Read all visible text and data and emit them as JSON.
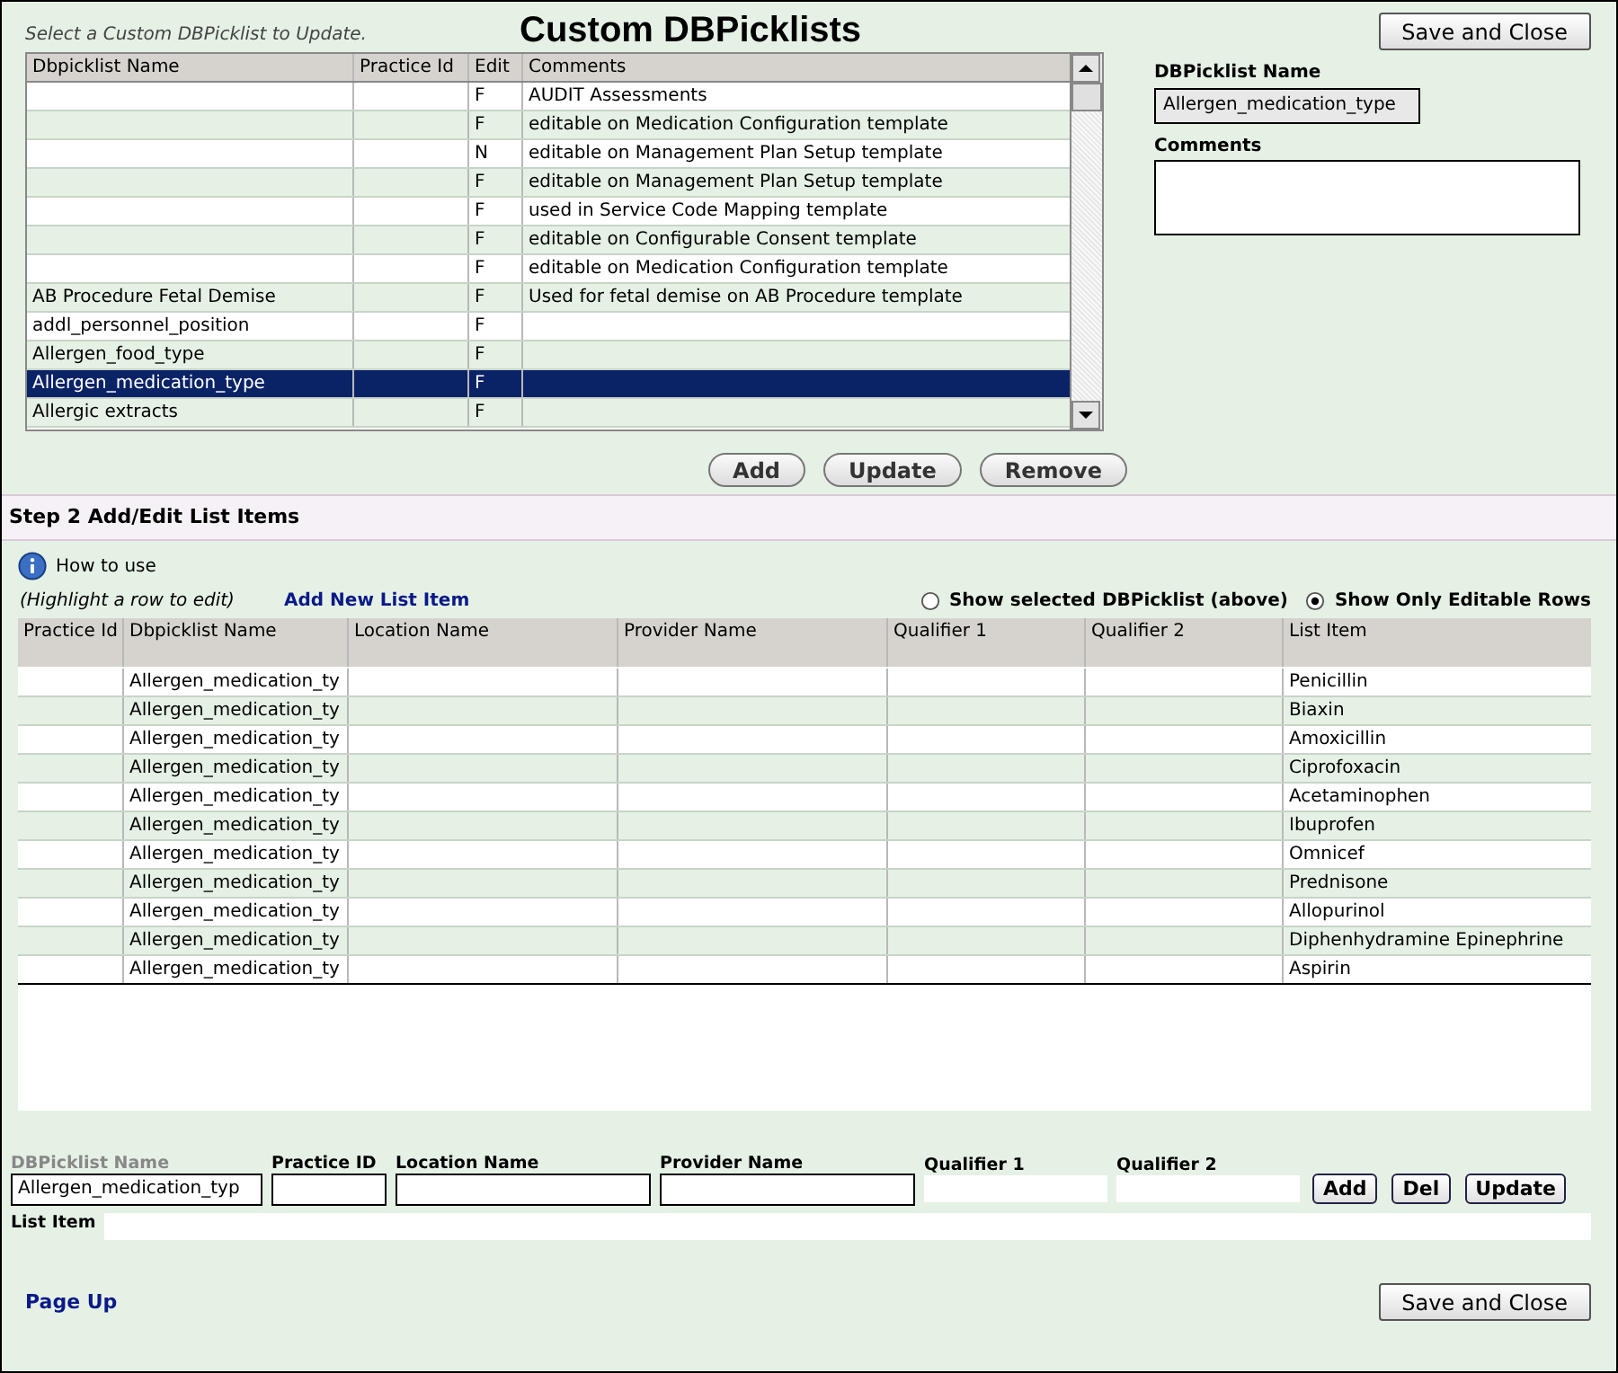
{
  "step1": {
    "instruction": "Select a Custom DBPicklist to Update.",
    "title": "Custom DBPicklists",
    "save_button": "Save and Close",
    "table": {
      "columns": [
        "Dbpicklist Name",
        "Practice Id",
        "Edit",
        "Comments"
      ],
      "rows": [
        {
          "cells": [
            "",
            "",
            "F",
            "AUDIT Assessments"
          ],
          "selected": false
        },
        {
          "cells": [
            "",
            "",
            "F",
            "editable on Medication Configuration template"
          ],
          "selected": false
        },
        {
          "cells": [
            "",
            "",
            "N",
            "editable on  Management Plan Setup template"
          ],
          "selected": false
        },
        {
          "cells": [
            "",
            "",
            "F",
            "editable on Management Plan Setup template"
          ],
          "selected": false
        },
        {
          "cells": [
            "",
            "",
            "F",
            "used in Service Code Mapping template"
          ],
          "selected": false
        },
        {
          "cells": [
            "",
            "",
            "F",
            "editable on Configurable Consent template"
          ],
          "selected": false
        },
        {
          "cells": [
            "",
            "",
            "F",
            "editable on Medication Configuration template"
          ],
          "selected": false
        },
        {
          "cells": [
            "AB Procedure Fetal Demise",
            "",
            "F",
            "Used for fetal demise on AB Procedure template"
          ],
          "selected": false
        },
        {
          "cells": [
            "addl_personnel_position",
            "",
            "F",
            ""
          ],
          "selected": false
        },
        {
          "cells": [
            "Allergen_food_type",
            "",
            "F",
            ""
          ],
          "selected": false
        },
        {
          "cells": [
            "Allergen_medication_type",
            "",
            "F",
            ""
          ],
          "selected": true
        },
        {
          "cells": [
            "Allergic extracts",
            "",
            "F",
            ""
          ],
          "selected": false
        }
      ]
    },
    "buttons": [
      "Add",
      "Update",
      "Remove"
    ],
    "name_label": "DBPicklist Name",
    "name_value": "Allergen_medication_type",
    "comments_label": "Comments"
  },
  "step2": {
    "title": "Step 2 Add/Edit List Items",
    "how_to_use": "How to use",
    "hint": "(Highlight a row to edit)",
    "add_link": "Add New List Item",
    "radios": [
      {
        "label": "Show selected DBPicklist (above)",
        "selected": false
      },
      {
        "label": "Show Only Editable Rows",
        "selected": true
      }
    ],
    "table": {
      "columns": [
        "Practice Id",
        "Dbpicklist Name",
        "Location Name",
        "Provider Name",
        "Qualifier 1",
        "Qualifier 2",
        "List Item"
      ],
      "rows": [
        [
          "",
          "Allergen_medication_ty",
          "",
          "",
          "",
          "",
          "Penicillin"
        ],
        [
          "",
          "Allergen_medication_ty",
          "",
          "",
          "",
          "",
          "Biaxin"
        ],
        [
          "",
          "Allergen_medication_ty",
          "",
          "",
          "",
          "",
          "Amoxicillin"
        ],
        [
          "",
          "Allergen_medication_ty",
          "",
          "",
          "",
          "",
          "Ciprofoxacin"
        ],
        [
          "",
          "Allergen_medication_ty",
          "",
          "",
          "",
          "",
          "Acetaminophen"
        ],
        [
          "",
          "Allergen_medication_ty",
          "",
          "",
          "",
          "",
          "Ibuprofen"
        ],
        [
          "",
          "Allergen_medication_ty",
          "",
          "",
          "",
          "",
          "Omnicef"
        ],
        [
          "",
          "Allergen_medication_ty",
          "",
          "",
          "",
          "",
          "Prednisone"
        ],
        [
          "",
          "Allergen_medication_ty",
          "",
          "",
          "",
          "",
          "Allopurinol"
        ],
        [
          "",
          "Allergen_medication_ty",
          "",
          "",
          "",
          "",
          "Diphenhydramine Epinephrine"
        ],
        [
          "",
          "Allergen_medication_ty",
          "",
          "",
          "",
          "",
          "Aspirin"
        ]
      ]
    },
    "form": [
      {
        "label": "DBPicklist Name",
        "value": "Allergen_medication_typ",
        "disabled": true,
        "kind": "boxed"
      },
      {
        "label": "Practice ID",
        "disabled": false,
        "kind": "boxed"
      },
      {
        "label": "Location Name",
        "disabled": false,
        "kind": "boxed"
      },
      {
        "label": "Provider Name",
        "disabled": false,
        "kind": "boxed"
      },
      {
        "label": "Qualifier 1",
        "disabled": false,
        "kind": "plain"
      },
      {
        "label": "Qualifier 2",
        "disabled": false,
        "kind": "plain"
      }
    ],
    "form_buttons": [
      "Add",
      "Del",
      "Update"
    ],
    "list_item": {
      "label": "List Item"
    },
    "page_up": "Page Up",
    "save_button": "Save and Close"
  }
}
